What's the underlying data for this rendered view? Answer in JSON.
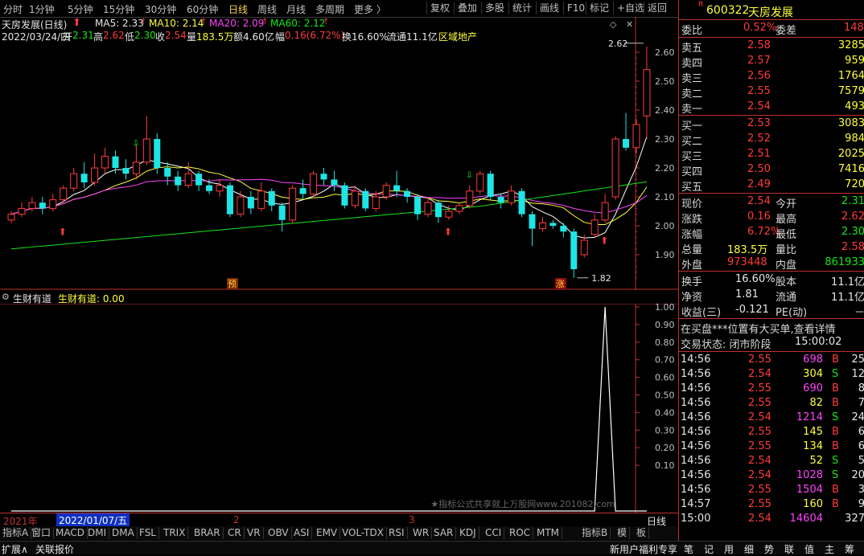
{
  "toolbar": {
    "periods": [
      "分时",
      "1分钟",
      "5分钟",
      "15分钟",
      "30分钟",
      "60分钟",
      "日线",
      "周线",
      "月线",
      "多周期",
      "更多 〉"
    ],
    "active_period": "日线",
    "buttons": [
      "复权",
      "叠加",
      "多股",
      "统计",
      "画线",
      "F10",
      "标记",
      "+自选",
      "返回"
    ]
  },
  "chart_header": {
    "stock_title": "天房发展(日线)",
    "ma5_label": "MA5: 2.33",
    "ma10_label": "MA10: 2.14",
    "ma20_label": "MA20: 2.09",
    "ma60_label": "MA60: 2.12",
    "date": "2022/03/24/四",
    "open_label": "开",
    "open": "2.31",
    "high_label": "高",
    "high": "2.62",
    "low_label": "低",
    "low": "2.30",
    "close_label": "收",
    "close": "2.54",
    "vol_label": "量",
    "vol": "183.5万",
    "amount_label": "额",
    "amount": "4.60亿",
    "chg_label": "幅",
    "chg": "0.16(6.72%)",
    "turnover": "换16.60%",
    "float": "流通11.1亿",
    "sector": "区域地产"
  },
  "main_price_labels": {
    "high": "2.62",
    "low": "1.82"
  },
  "markers": {
    "pre": "预",
    "up": "涨"
  },
  "sub_indicator": {
    "name": "生财有道",
    "value_label": "生财有道: 0.00"
  },
  "axis_dates": {
    "year": "2021年",
    "cursor": "2022/01/07/五",
    "m2": "2",
    "m3": "3",
    "period": "日线"
  },
  "watermark": "★指标公式共享就上万股网www.201082.com",
  "indicator_tabs": [
    "指标A",
    "窗口",
    "MACD",
    "DMI",
    "DMA",
    "FSL",
    "TRIX",
    "BRAR",
    "CR",
    "VR",
    "OBV",
    "ASI",
    "EMV",
    "VOL-TDX",
    "RSI",
    "WR",
    "SAR",
    "KDJ",
    "CCI",
    "ROC",
    "MTM"
  ],
  "indicator_tabs_right": [
    "指标B",
    "模",
    "板"
  ],
  "bottom": {
    "expand": "扩展∧",
    "close_quote": "关联报价",
    "right": "新用户福利专享"
  },
  "bottom_right_icons": [
    "笔",
    "记",
    "用",
    "细",
    "势",
    "联",
    "值",
    "主",
    "筹"
  ],
  "quote_panel": {
    "code": "600322",
    "name": "天房发展",
    "weibi_label": "委比",
    "weibi": "0.52%",
    "weicha_label": "委差",
    "weicha": "148",
    "asks": [
      {
        "label": "卖五",
        "price": "2.58",
        "vol": "3285"
      },
      {
        "label": "卖四",
        "price": "2.57",
        "vol": "959"
      },
      {
        "label": "卖三",
        "price": "2.56",
        "vol": "1764"
      },
      {
        "label": "卖二",
        "price": "2.55",
        "vol": "7579"
      },
      {
        "label": "卖一",
        "price": "2.54",
        "vol": "493"
      }
    ],
    "bids": [
      {
        "label": "买一",
        "price": "2.53",
        "vol": "3083"
      },
      {
        "label": "买二",
        "price": "2.52",
        "vol": "984"
      },
      {
        "label": "买三",
        "price": "2.51",
        "vol": "2025"
      },
      {
        "label": "买四",
        "price": "2.50",
        "vol": "7416"
      },
      {
        "label": "买五",
        "price": "2.49",
        "vol": "720"
      }
    ],
    "stats": [
      {
        "l1": "现价",
        "v1": "2.54",
        "c1": "red",
        "l2": "今开",
        "v2": "2.31",
        "c2": "green"
      },
      {
        "l1": "涨跌",
        "v1": "0.16",
        "c1": "red",
        "l2": "最高",
        "v2": "2.62",
        "c2": "red"
      },
      {
        "l1": "涨幅",
        "v1": "6.72%",
        "c1": "red",
        "l2": "最低",
        "v2": "2.30",
        "c2": "green"
      },
      {
        "l1": "总量",
        "v1": "183.5万",
        "c1": "yellow",
        "l2": "量比",
        "v2": "2.58",
        "c2": "red"
      },
      {
        "l1": "外盘",
        "v1": "973448",
        "c1": "red",
        "l2": "内盘",
        "v2": "861933",
        "c2": "green"
      }
    ],
    "stats2": [
      {
        "l1": "换手",
        "v1": "16.60%",
        "l2": "股本",
        "v2": "11.1亿"
      },
      {
        "l1": "净资",
        "v1": "1.81",
        "l2": "流通",
        "v2": "11.1亿"
      },
      {
        "l1": "收益(三)",
        "v1": "-0.121",
        "l2": "PE(动)",
        "v2": "－"
      }
    ],
    "notice": "在买盘***位置有大买单,查看详情",
    "status_label": "交易状态: 闭市阶段",
    "status_time": "15:00:02",
    "ticks": [
      {
        "t": "14:56",
        "p": "2.55",
        "v": "698",
        "v_color": "mag",
        "s": "B",
        "n": "25"
      },
      {
        "t": "14:56",
        "p": "2.54",
        "v": "304",
        "v_color": "yellow",
        "s": "S",
        "n": "12"
      },
      {
        "t": "14:56",
        "p": "2.55",
        "v": "690",
        "v_color": "mag",
        "s": "B",
        "n": "8"
      },
      {
        "t": "14:56",
        "p": "2.55",
        "v": "82",
        "v_color": "yellow",
        "s": "B",
        "n": "7"
      },
      {
        "t": "14:56",
        "p": "2.54",
        "v": "1214",
        "v_color": "mag",
        "s": "S",
        "n": "24"
      },
      {
        "t": "14:56",
        "p": "2.55",
        "v": "145",
        "v_color": "yellow",
        "s": "B",
        "n": "6"
      },
      {
        "t": "14:56",
        "p": "2.55",
        "v": "134",
        "v_color": "yellow",
        "s": "B",
        "n": "6"
      },
      {
        "t": "14:56",
        "p": "2.54",
        "v": "52",
        "v_color": "yellow",
        "s": "S",
        "n": "5"
      },
      {
        "t": "14:56",
        "p": "2.54",
        "v": "1028",
        "v_color": "mag",
        "s": "S",
        "n": "20"
      },
      {
        "t": "14:56",
        "p": "2.55",
        "v": "1504",
        "v_color": "mag",
        "s": "B",
        "n": "3"
      },
      {
        "t": "14:57",
        "p": "2.55",
        "v": "160",
        "v_color": "yellow",
        "s": "B",
        "n": "9"
      },
      {
        "t": "15:00",
        "p": "2.54",
        "v": "14604",
        "v_color": "mag",
        "s": "",
        "n": "327"
      }
    ]
  },
  "colors": {
    "up": "#ff3b3b",
    "down": "#1ee5e5",
    "ma5": "#ffffff",
    "ma10": "#ffff3b",
    "ma20": "#ff44ff",
    "ma60": "#17e617",
    "grid": "#7a1010"
  },
  "chart_data": {
    "type": "candlestick",
    "y_ticks": [
      "2.60",
      "2.50",
      "2.40",
      "2.30",
      "2.20",
      "2.10",
      "2.00",
      "1.90"
    ],
    "sub_y_ticks": [
      "1.00",
      "0.90",
      "0.80",
      "0.70",
      "0.60",
      "0.50",
      "0.40",
      "0.30",
      "0.20",
      "0.10"
    ],
    "candles": [
      [
        2.02,
        2.04,
        2.05,
        2.01
      ],
      [
        2.04,
        2.06,
        2.08,
        2.03
      ],
      [
        2.06,
        2.08,
        2.1,
        2.05
      ],
      [
        2.08,
        2.06,
        2.1,
        2.04
      ],
      [
        2.06,
        2.09,
        2.11,
        2.05
      ],
      [
        2.09,
        2.13,
        2.14,
        2.08
      ],
      [
        2.13,
        2.18,
        2.2,
        2.12
      ],
      [
        2.18,
        2.15,
        2.22,
        2.13
      ],
      [
        2.15,
        2.2,
        2.25,
        2.14
      ],
      [
        2.2,
        2.24,
        2.27,
        2.18
      ],
      [
        2.24,
        2.2,
        2.26,
        2.18
      ],
      [
        2.2,
        2.18,
        2.23,
        2.16
      ],
      [
        2.18,
        2.22,
        2.28,
        2.16
      ],
      [
        2.22,
        2.3,
        2.38,
        2.21
      ],
      [
        2.3,
        2.2,
        2.32,
        2.18
      ],
      [
        2.2,
        2.17,
        2.22,
        2.14
      ],
      [
        2.17,
        2.14,
        2.19,
        2.12
      ],
      [
        2.14,
        2.18,
        2.22,
        2.13
      ],
      [
        2.18,
        2.14,
        2.19,
        2.12
      ],
      [
        2.14,
        2.12,
        2.16,
        2.11
      ],
      [
        2.12,
        2.14,
        2.16,
        2.1
      ],
      [
        2.14,
        2.04,
        2.15,
        2.03
      ],
      [
        2.04,
        2.1,
        2.12,
        2.03
      ],
      [
        2.1,
        2.06,
        2.12,
        2.04
      ],
      [
        2.06,
        2.12,
        2.15,
        2.05
      ],
      [
        2.12,
        2.07,
        2.13,
        2.05
      ],
      [
        2.07,
        2.02,
        2.08,
        1.98
      ],
      [
        2.02,
        2.13,
        2.14,
        2.01
      ],
      [
        2.13,
        2.11,
        2.16,
        2.09
      ],
      [
        2.11,
        2.18,
        2.19,
        2.1
      ],
      [
        2.18,
        2.16,
        2.2,
        2.14
      ],
      [
        2.16,
        2.14,
        2.19,
        2.12
      ],
      [
        2.14,
        2.07,
        2.15,
        2.06
      ],
      [
        2.07,
        2.12,
        2.14,
        2.06
      ],
      [
        2.12,
        2.06,
        2.13,
        2.05
      ],
      [
        2.06,
        2.1,
        2.12,
        2.05
      ],
      [
        2.1,
        2.14,
        2.15,
        2.09
      ],
      [
        2.14,
        2.12,
        2.19,
        2.1
      ],
      [
        2.12,
        2.1,
        2.13,
        2.08
      ],
      [
        2.1,
        2.04,
        2.11,
        2.02
      ],
      [
        2.04,
        2.08,
        2.1,
        2.03
      ],
      [
        2.08,
        2.03,
        2.09,
        2.01
      ],
      [
        2.03,
        2.05,
        2.07,
        2.02
      ],
      [
        2.05,
        2.07,
        2.08,
        2.04
      ],
      [
        2.07,
        2.12,
        2.14,
        2.06
      ],
      [
        2.12,
        2.18,
        2.19,
        2.11
      ],
      [
        2.18,
        2.1,
        2.19,
        2.09
      ],
      [
        2.1,
        2.08,
        2.11,
        2.06
      ],
      [
        2.08,
        2.12,
        2.14,
        2.07
      ],
      [
        2.12,
        2.04,
        2.13,
        2.03
      ],
      [
        2.04,
        1.99,
        2.05,
        1.93
      ],
      [
        1.99,
        2.01,
        2.03,
        1.98
      ],
      [
        2.01,
        2.0,
        2.02,
        1.99
      ],
      [
        2.0,
        1.98,
        2.01,
        1.96
      ],
      [
        1.98,
        1.85,
        1.99,
        1.82
      ],
      [
        1.9,
        1.95,
        1.97,
        1.89
      ],
      [
        1.97,
        2.02,
        2.04,
        1.96
      ],
      [
        2.02,
        2.08,
        2.11,
        2.01
      ],
      [
        2.1,
        2.3,
        2.31,
        2.09
      ],
      [
        2.3,
        2.27,
        2.39,
        2.26
      ],
      [
        2.27,
        2.35,
        2.37,
        2.25
      ],
      [
        2.38,
        2.54,
        2.62,
        2.3
      ]
    ],
    "signal": [
      0,
      0,
      0,
      0,
      0,
      0,
      0,
      0,
      0,
      0,
      0,
      0,
      0,
      0,
      0,
      0,
      0,
      0,
      0,
      0,
      0,
      0,
      0,
      0,
      0,
      0,
      0,
      0,
      0,
      0,
      0,
      0,
      0,
      0,
      0,
      0,
      0,
      0,
      0,
      0,
      0,
      0,
      0,
      0,
      0,
      0,
      0,
      0,
      0,
      0,
      0,
      0,
      0,
      0,
      0,
      0,
      0,
      1,
      0,
      0,
      0,
      0
    ]
  }
}
